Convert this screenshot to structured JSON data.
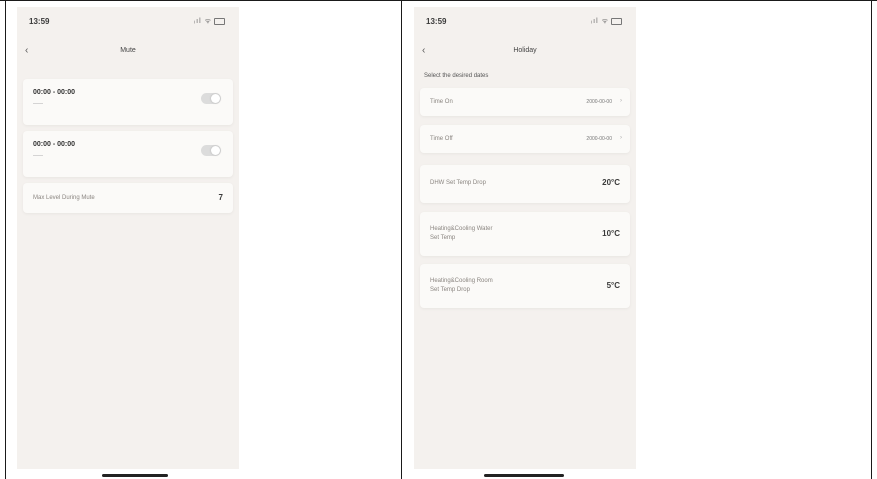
{
  "left_screen": {
    "status_time": "13:59",
    "status_icons": "ᵢıl ᯤ",
    "back_glyph": "‹",
    "title": "Mute",
    "cards": [
      {
        "time_range": "00:00 - 00:00",
        "sub": "——",
        "toggle_on": false
      },
      {
        "time_range": "00:00 - 00:00",
        "sub": "——",
        "toggle_on": false
      }
    ],
    "max_level_label": "Max Level During Mute",
    "max_level_value": "7"
  },
  "right_screen": {
    "status_time": "13:59",
    "status_icons": "ᵢıl ᯤ",
    "back_glyph": "‹",
    "title": "Holiday",
    "section_label": "Select the desired dates",
    "date_rows": [
      {
        "label": "Time On",
        "value": "2000-00-00",
        "chevron": "›"
      },
      {
        "label": "Time Off",
        "value": "2000-00-00",
        "chevron": "›"
      }
    ],
    "temp_rows": [
      {
        "label_line1": "DHW Set Temp Drop",
        "label_line2": "",
        "value": "20°C"
      },
      {
        "label_line1": "Heating&Cooling Water",
        "label_line2": "Set Temp",
        "value": "10°C"
      },
      {
        "label_line1": "Heating&Cooling Room",
        "label_line2": "Set Temp Drop",
        "value": "5°C"
      }
    ]
  }
}
